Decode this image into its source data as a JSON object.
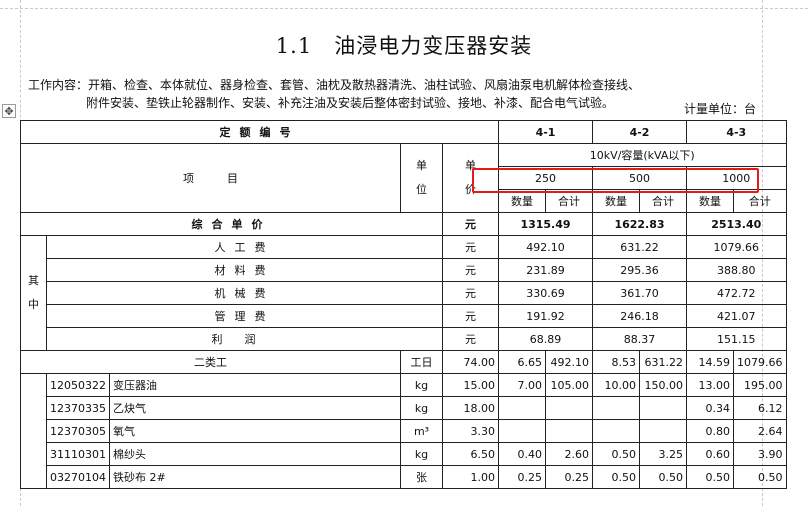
{
  "title": "1.1　油浸电力变压器安装",
  "work_content": {
    "line1": "工作内容：开箱、检查、本体就位、器身检查、套管、油枕及散热器清洗、油柱试验、风扇油泵电机解体检查接线、",
    "line2": "附件安装、垫铁止轮器制作、安装、补充注油及安装后整体密封试验、接地、补漆、配合电气试验。"
  },
  "unit_label": "计量单位：台",
  "move_handle_icon": "move-handle-icon",
  "table": {
    "header": {
      "quota_label": "定额编号",
      "codes": [
        "4-1",
        "4-2",
        "4-3"
      ],
      "item_label": "项　　　目",
      "unit_label": "单位",
      "price_label": "单价",
      "spec_label": "10kV/容量(kVA以下)",
      "capacities": [
        "250",
        "500",
        "1000"
      ],
      "qty_label": "数量",
      "total_label": "合计"
    },
    "summary": {
      "label": "综合单价",
      "unit": "元",
      "values": [
        "1315.49",
        "1622.83",
        "2513.40"
      ]
    },
    "of_which_label": "其中",
    "breakdown": [
      {
        "label": "人工费",
        "unit": "元",
        "values": [
          "492.10",
          "631.22",
          "1079.66"
        ]
      },
      {
        "label": "材料费",
        "unit": "元",
        "values": [
          "231.89",
          "295.36",
          "388.80"
        ]
      },
      {
        "label": "机械费",
        "unit": "元",
        "values": [
          "330.69",
          "361.70",
          "472.72"
        ]
      },
      {
        "label": "管理费",
        "unit": "元",
        "values": [
          "191.92",
          "246.18",
          "421.07"
        ]
      },
      {
        "label": "利润",
        "unit": "元",
        "values": [
          "68.89",
          "88.37",
          "151.15"
        ]
      }
    ],
    "labor": {
      "label": "二类工",
      "unit": "工日",
      "price": "74.00",
      "cells": [
        "6.65",
        "492.10",
        "8.53",
        "631.22",
        "14.59",
        "1079.66"
      ]
    },
    "materials": [
      {
        "code": "12050322",
        "name": "变压器油",
        "unit": "kg",
        "price": "15.00",
        "cells": [
          "7.00",
          "105.00",
          "10.00",
          "150.00",
          "13.00",
          "195.00"
        ]
      },
      {
        "code": "12370335",
        "name": "乙炔气",
        "unit": "kg",
        "price": "18.00",
        "cells": [
          "",
          "",
          "",
          "",
          "0.34",
          "6.12"
        ]
      },
      {
        "code": "12370305",
        "name": "氧气",
        "unit": "m³",
        "price": "3.30",
        "cells": [
          "",
          "",
          "",
          "",
          "0.80",
          "2.64"
        ]
      },
      {
        "code": "31110301",
        "name": "棉纱头",
        "unit": "kg",
        "price": "6.50",
        "cells": [
          "0.40",
          "2.60",
          "0.50",
          "3.25",
          "0.60",
          "3.90"
        ]
      },
      {
        "code": "03270104",
        "name": "铁砂布 2#",
        "unit": "张",
        "price": "1.00",
        "cells": [
          "0.25",
          "0.25",
          "0.50",
          "0.50",
          "0.50",
          "0.50"
        ]
      }
    ]
  },
  "highlight_color": "#e21b1b"
}
